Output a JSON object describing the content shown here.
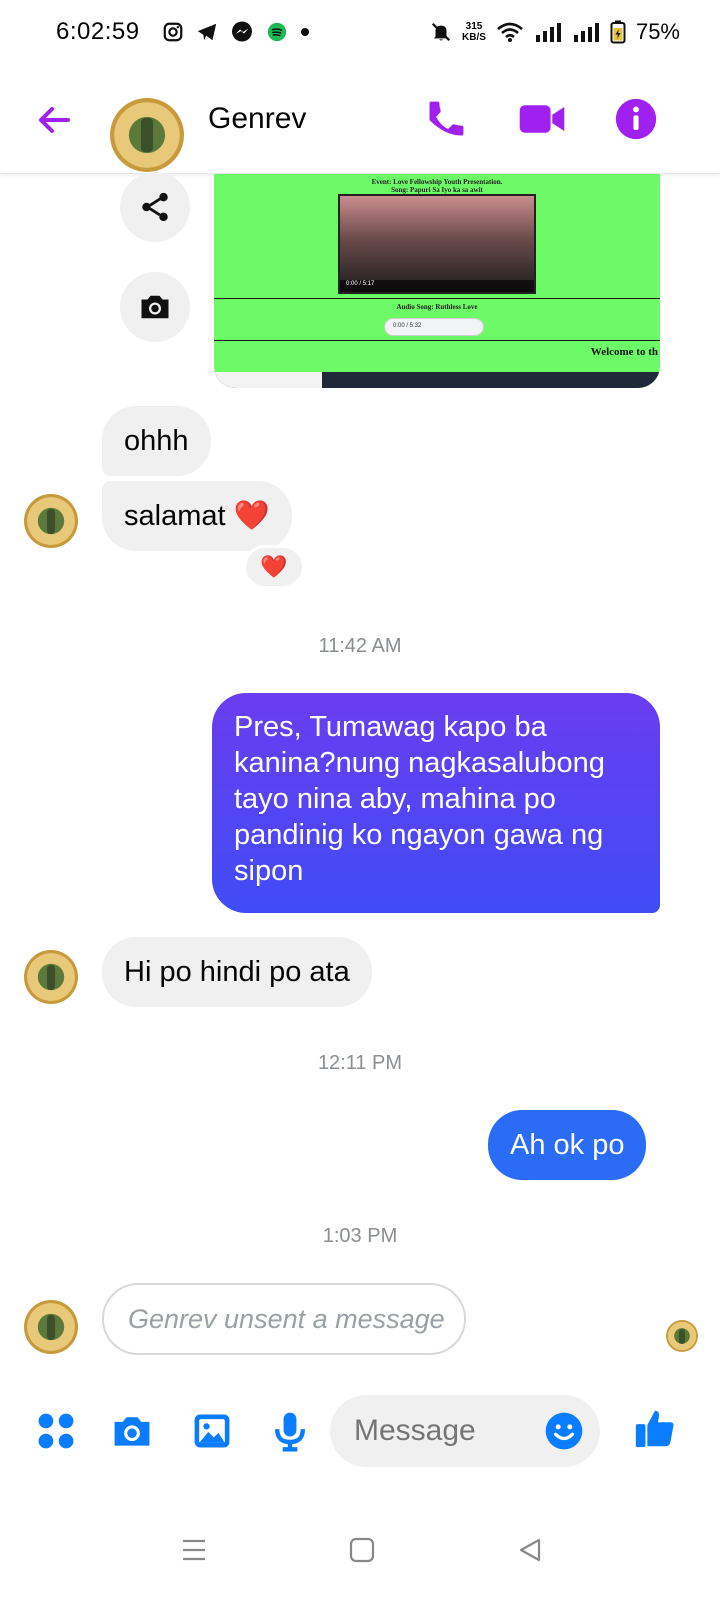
{
  "status_bar": {
    "time": "6:02:59",
    "speed_value": "315",
    "speed_unit": "KB/S",
    "battery": "75%"
  },
  "header": {
    "contact_name": "Genrev",
    "icons": [
      "back-arrow-icon",
      "phone-icon",
      "video-camera-icon",
      "info-icon"
    ],
    "accent_color": "#a020f0"
  },
  "shared_preview": {
    "title_line1": "Event: Love Fellowship Youth Presentation.",
    "title_line2": "Song: Papuri Sa Iyo ka sa awit",
    "audio_title": "Audio Song: Ruthless Love",
    "welcome_text": "Welcome to th",
    "video_time": "0:00 / 5:17",
    "audio_time": "0:00 / 5:32"
  },
  "messages": [
    {
      "sender": "Genrev",
      "text": "ohhh"
    },
    {
      "sender": "Genrev",
      "text": "salamat ❤️",
      "reaction": "❤️"
    },
    {
      "timestamp": "11:42 AM"
    },
    {
      "sender": "me",
      "text": "Pres, Tumawag kapo ba kanina?nung nagkasalubong tayo nina aby, mahina po pandinig ko ngayon gawa ng sipon"
    },
    {
      "sender": "Genrev",
      "text": "Hi po hindi po ata"
    },
    {
      "timestamp": "12:11 PM"
    },
    {
      "sender": "me",
      "text": "Ah ok po"
    },
    {
      "timestamp": "1:03 PM"
    },
    {
      "sender": "Genrev",
      "text": "Genrev unsent a message",
      "unsent": true
    }
  ],
  "composer": {
    "placeholder": "Message",
    "icons": [
      "apps-icon",
      "camera-icon",
      "gallery-icon",
      "microphone-icon",
      "emoji-icon",
      "thumbs-up-icon"
    ],
    "accent_color": "#0a7cff"
  },
  "bubble_colors": {
    "incoming": "#f0f0f0",
    "outgoing_purple": "#5b3df5",
    "outgoing_blue": "#2a6cf5"
  }
}
